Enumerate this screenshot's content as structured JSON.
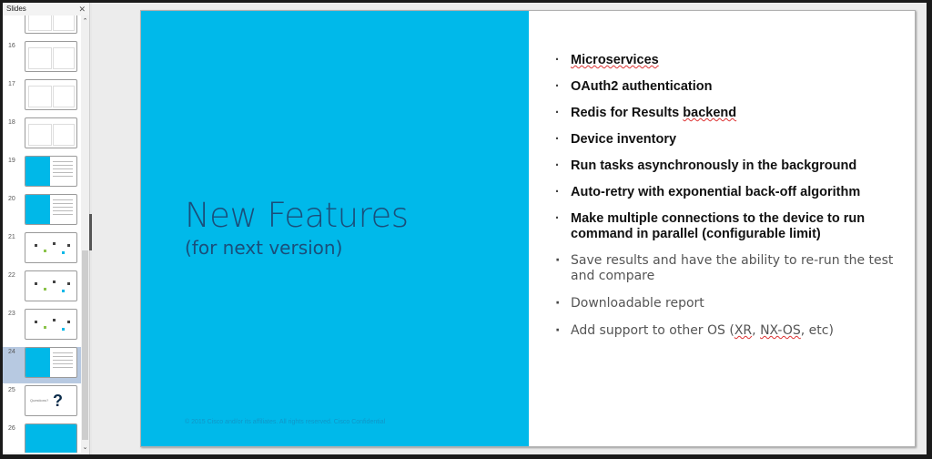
{
  "slides_pane": {
    "title": "Slides",
    "close_icon": "close-icon",
    "thumbnails": [
      {
        "number": "",
        "kind": "content"
      },
      {
        "number": "16",
        "kind": "content"
      },
      {
        "number": "17",
        "kind": "content"
      },
      {
        "number": "18",
        "kind": "content"
      },
      {
        "number": "19",
        "kind": "split-cyan"
      },
      {
        "number": "20",
        "kind": "split-cyan"
      },
      {
        "number": "21",
        "kind": "diagram"
      },
      {
        "number": "22",
        "kind": "diagram"
      },
      {
        "number": "23",
        "kind": "diagram"
      },
      {
        "number": "24",
        "kind": "split-cyan",
        "selected": true
      },
      {
        "number": "25",
        "kind": "questions",
        "label": "Questions?",
        "glyph": "?"
      },
      {
        "number": "26",
        "kind": "full-cyan"
      }
    ],
    "scroll_up_glyph": "⌃",
    "scroll_down_glyph": "⌄"
  },
  "slide": {
    "title": "New Features",
    "subtitle": "(for next version)",
    "footer": "© 2015 Cisco and/or its affiliates. All rights reserved. Cisco Confidential",
    "accent_color": "#00b9ea",
    "bullets": [
      {
        "text": "Microservices",
        "style": "bold"
      },
      {
        "text": "OAuth2 authentication",
        "style": "bold"
      },
      {
        "text_before": "Redis for Results ",
        "text_flagged": "backend",
        "style": "bold"
      },
      {
        "text": "Device inventory",
        "style": "bold"
      },
      {
        "text": "Run tasks asynchronously in the background",
        "style": "bold"
      },
      {
        "text": "Auto-retry with exponential back-off algorithm",
        "style": "bold"
      },
      {
        "text": "Make multiple connections to the device to run command in parallel (configurable limit)",
        "style": "bold"
      },
      {
        "text": "Save results and have the ability to re-run the test and compare",
        "style": "light"
      },
      {
        "text": "Downloadable report",
        "style": "light"
      },
      {
        "text_before": "Add support to other OS (",
        "flag1": "XR",
        "sep": ", ",
        "flag2": "NX-OS",
        "text_after": ", etc)",
        "style": "light"
      }
    ]
  }
}
